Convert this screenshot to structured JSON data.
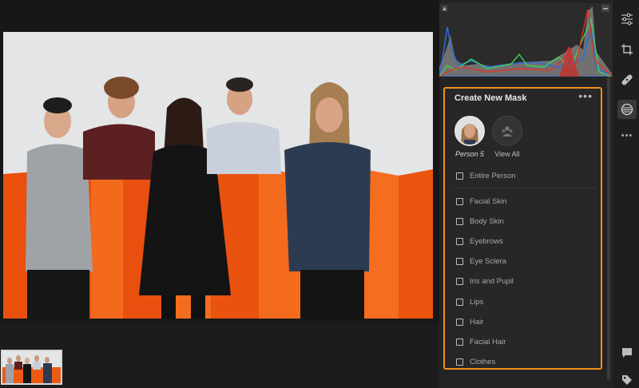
{
  "mask_panel": {
    "title": "Create New Mask",
    "more_label": "•••",
    "person_label": "Person 5",
    "view_all_label": "View All",
    "options": [
      {
        "label": "Entire Person",
        "checked": false
      },
      {
        "label": "Facial Skin",
        "checked": false
      },
      {
        "label": "Body Skin",
        "checked": false
      },
      {
        "label": "Eyebrows",
        "checked": false
      },
      {
        "label": "Eye Sclera",
        "checked": false
      },
      {
        "label": "Iris and Pupil",
        "checked": false
      },
      {
        "label": "Lips",
        "checked": false
      },
      {
        "label": "Hair",
        "checked": false
      },
      {
        "label": "Facial Hair",
        "checked": false
      },
      {
        "label": "Clothes",
        "checked": false
      }
    ]
  },
  "toolbar": {
    "tools": [
      "edit-sliders-icon",
      "crop-icon",
      "healing-bandage-icon",
      "masking-icon",
      "more-icon"
    ],
    "bottom_tools": [
      "comment-icon",
      "tag-icon"
    ],
    "more_label": "•••"
  },
  "colors": {
    "accent_highlight": "#f0901c",
    "backdrop_orange": "#f25a10"
  }
}
